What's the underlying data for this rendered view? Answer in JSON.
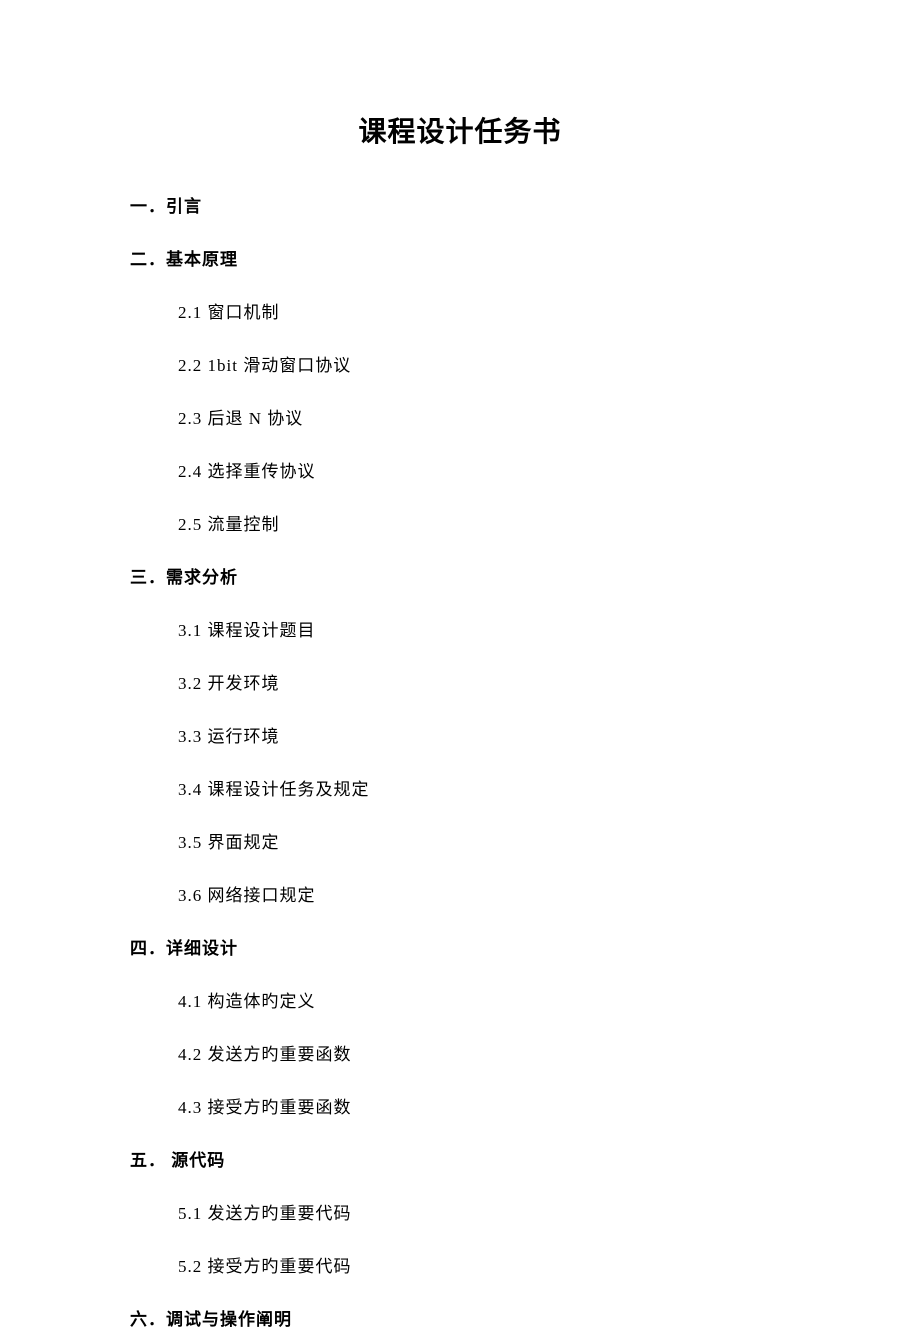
{
  "title": "课程设计任务书",
  "sections": [
    {
      "heading": "一．引言",
      "items": []
    },
    {
      "heading": "二．基本原理",
      "items": [
        "2.1 窗口机制",
        "2.2 1bit 滑动窗口协议",
        "2.3 后退 N 协议",
        "2.4 选择重传协议",
        "2.5 流量控制"
      ]
    },
    {
      "heading": "三．需求分析",
      "items": [
        "3.1 课程设计题目",
        "3.2 开发环境",
        "3.3 运行环境",
        "3.4 课程设计任务及规定",
        "3.5 界面规定",
        "3.6 网络接口规定"
      ]
    },
    {
      "heading": "四．详细设计",
      "items": [
        "4.1 构造体旳定义",
        "4.2 发送方旳重要函数",
        "4.3 接受方旳重要函数"
      ]
    },
    {
      "heading": "五． 源代码",
      "items": [
        "5.1 发送方旳重要代码",
        "5.2 接受方旳重要代码"
      ]
    },
    {
      "heading": "六．调试与操作阐明",
      "items": []
    }
  ]
}
